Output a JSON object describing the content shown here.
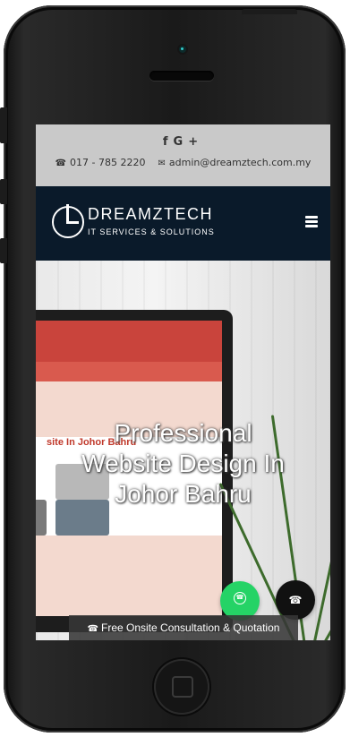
{
  "topbar": {
    "social_icons": [
      "facebook-icon",
      "google-plus-icon"
    ],
    "social_glyphs": {
      "facebook": "f",
      "googleplus": "G+"
    },
    "phone": "017 - 785 2220",
    "email": "admin@dreamztech.com.my"
  },
  "navbar": {
    "logo_name": "DREAMZTECH",
    "logo_tagline": "IT SERVICES & SOLUTIONS"
  },
  "hero": {
    "title_line1": "Professional",
    "title_line2": "Website Design In",
    "title_line3": "Johor Bahru",
    "monitor_heading": "site In Johor Bahru"
  },
  "floating": {
    "cta_label": "Free Onsite Consultation & Quotation"
  },
  "colors": {
    "topbar_bg": "#c9c9c9",
    "navbar_bg": "#0a1a2a",
    "whatsapp": "#25d366",
    "call_button": "#111111"
  }
}
